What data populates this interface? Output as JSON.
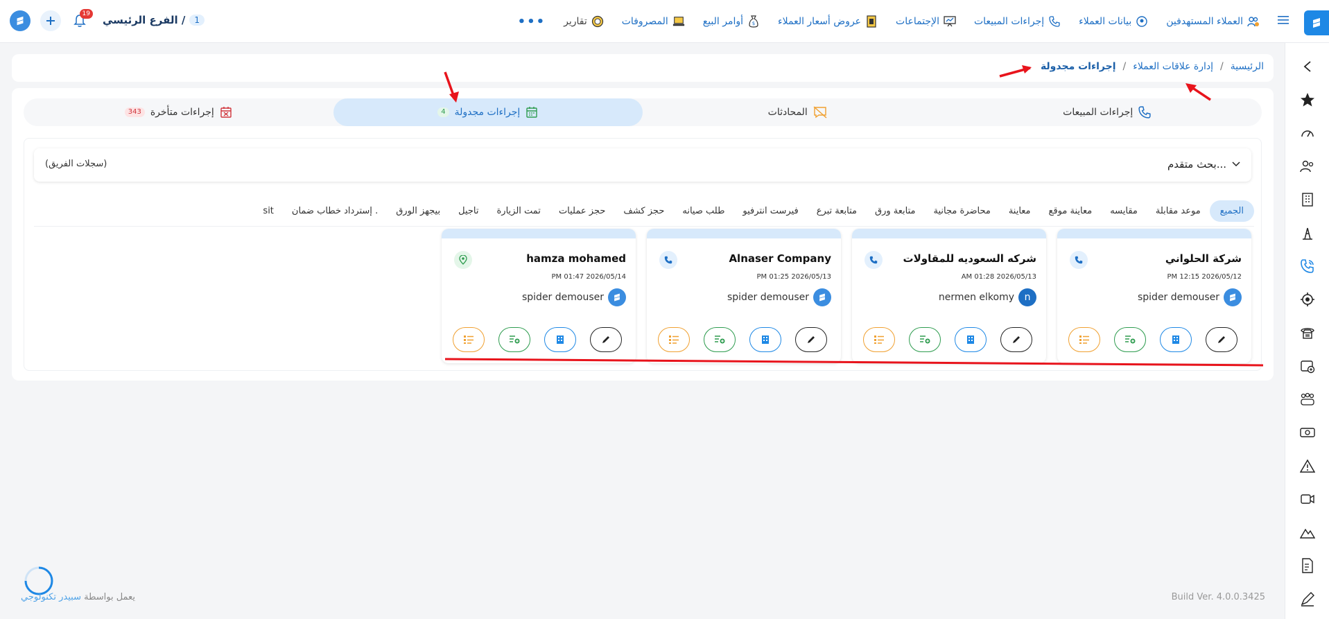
{
  "topbar": {
    "nav": [
      {
        "label": "العملاء المستهدفين",
        "icon": "people-target-icon",
        "dark": false
      },
      {
        "label": "بيانات العملاء",
        "icon": "client-data-icon",
        "dark": false
      },
      {
        "label": "إجراءات المبيعات",
        "icon": "phone-icon",
        "dark": false
      },
      {
        "label": "الإجتماعات",
        "icon": "presentation-icon",
        "dark": false
      },
      {
        "label": "عروض أسعار العملاء",
        "icon": "quote-icon",
        "dark": false
      },
      {
        "label": "أوامر البيع",
        "icon": "money-bag-icon",
        "dark": false
      },
      {
        "label": "المصروفات",
        "icon": "laptop-icon",
        "dark": false
      },
      {
        "label": "تقارير",
        "icon": "chart-circle-icon",
        "dark": true
      }
    ],
    "more": "•••",
    "branch_label": "الفرع الرئيسي /",
    "branch_number": "1",
    "notification_count": "19"
  },
  "breadcrumb": {
    "home": "الرئيسية",
    "section": "إدارة علاقات العملاء",
    "current": "إجراءات مجدولة",
    "sep": "/"
  },
  "tabs": [
    {
      "label": "إجراءات المبيعات",
      "icon": "phone-icon",
      "badge": "",
      "active": false
    },
    {
      "label": "المحادثات",
      "icon": "chat-off-icon",
      "badge": "",
      "active": false
    },
    {
      "label": "إجراءات مجدولة",
      "icon": "calendar-icon",
      "badge": "4",
      "active": true
    },
    {
      "label": "إجراءات متأخرة",
      "icon": "calendar-x-icon",
      "badge": "343",
      "active": false
    }
  ],
  "search": {
    "advanced_label": "بحث متقدم...",
    "team_records": "(سجلات الفريق)"
  },
  "filters": [
    "الجميع",
    "موعد مقابلة",
    "مقايسه",
    "معاينة موقع",
    "معاينة",
    "محاضرة مجانية",
    "متابعة ورق",
    "متابعة تبرع",
    "فيرست انترفيو",
    "طلب صيانه",
    "حجز كشف",
    "حجز عمليات",
    "تمت الزيارة",
    "تاجيل",
    "بيجهز الورق",
    "إسترداد خطاب ضمان .",
    "sit"
  ],
  "cards": [
    {
      "title": "شركة الحلواني",
      "date": "PM 12:15 2026/05/12",
      "user": "spider demouser",
      "avatar": "",
      "type": "phone"
    },
    {
      "title": "شركه السعوديه للمقاولات",
      "date": "AM 01:28 2026/05/13",
      "user": "nermen elkomy",
      "avatar": "n",
      "type": "phone"
    },
    {
      "title": "Alnaser Company",
      "date": "PM 01:25 2026/05/13",
      "user": "spider demouser",
      "avatar": "",
      "type": "phone"
    },
    {
      "title": "hamza mohamed",
      "date": "PM 01:47 2026/05/14",
      "user": "spider demouser",
      "avatar": "",
      "type": "location"
    }
  ],
  "footer": {
    "powered_prefix": "يعمل بواسطة",
    "powered_brand": "سبيدر تكنولوجي",
    "build": "Build Ver. 4.0.0.3425"
  },
  "colors": {
    "accent": "#1e88e5",
    "active_tab_bg": "#d7e9fb",
    "annotation_red": "#e8141c"
  }
}
